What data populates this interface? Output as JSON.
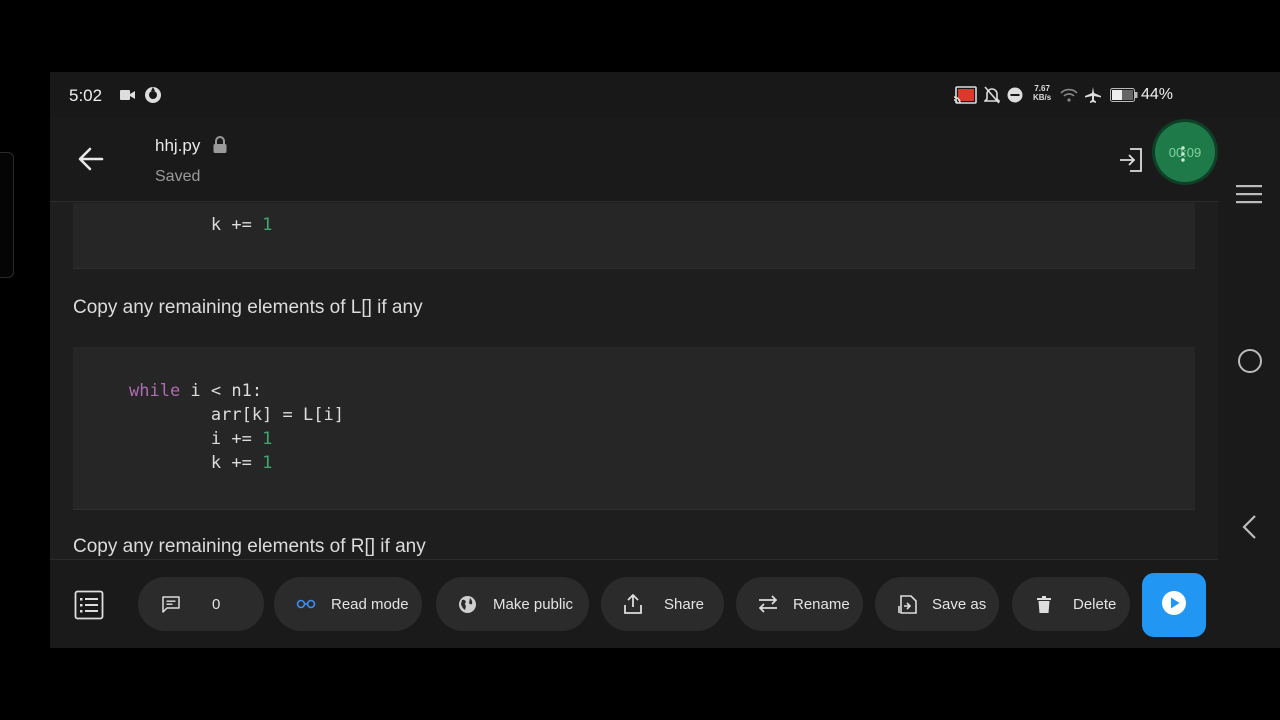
{
  "status_bar": {
    "time": "5:02",
    "net_speed_value": "7.67",
    "net_speed_unit": "KB/s",
    "battery": "44%",
    "icons": [
      "video-camera-icon",
      "app-icon",
      "cast-icon",
      "mute-icon",
      "do-not-disturb-icon",
      "wifi-icon",
      "airplane-icon",
      "battery-icon"
    ]
  },
  "header": {
    "file_name": "hhj.py",
    "status": "Saved",
    "recording_time": "00:09"
  },
  "content": {
    "code_block_1": [
      "        k += 1"
    ],
    "md_1": "Copy any remaining elements of L[] if any",
    "code_block_2": {
      "kw": "while",
      "line1_rest": " i < n1:",
      "line2": "        arr[k] = L[i]",
      "line3_pre": "        i += ",
      "line3_num": "1",
      "line4_pre": "        k += ",
      "line4_num": "1"
    },
    "code_block_1_pre": "        k += ",
    "code_block_1_num": "1",
    "md_2": "Copy any remaining elements of R[] if any"
  },
  "toolbar": {
    "comments_count": "0",
    "read_mode": "Read mode",
    "make_public": "Make public",
    "share": "Share",
    "rename": "Rename",
    "save_as": "Save as",
    "delete": "Delete"
  },
  "colors": {
    "accent": "#2196f3",
    "keyword": "#b06ab3",
    "number": "#3fa66b",
    "recorder": "#1e7a48"
  }
}
